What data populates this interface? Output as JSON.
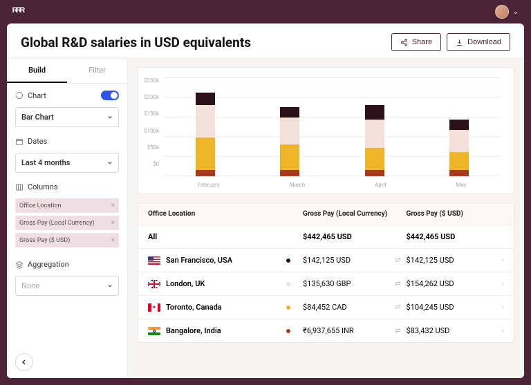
{
  "header": {
    "title": "Global R&D salaries in USD equivalents",
    "share_label": "Share",
    "download_label": "Download"
  },
  "sidebar": {
    "tabs": {
      "build": "Build",
      "filter": "Filter"
    },
    "chart_label": "Chart",
    "chart_type": "Bar Chart",
    "dates_label": "Dates",
    "dates_value": "Last 4 months",
    "columns_label": "Columns",
    "columns": [
      {
        "label": "Office Location"
      },
      {
        "label": "Gross Pay (Local Currency)"
      },
      {
        "label": "Gross Pay ($ USD)"
      }
    ],
    "aggregation_label": "Aggregation",
    "aggregation_value": "None"
  },
  "chart_data": {
    "type": "bar",
    "stacked": true,
    "ylabel": "",
    "ylim": [
      0,
      250
    ],
    "yticks": [
      "$250k",
      "$200k",
      "$150k",
      "$100k",
      "$50k",
      "$0"
    ],
    "categories": [
      "February",
      "March",
      "April",
      "May"
    ],
    "series": [
      {
        "name": "Bangalore, India",
        "color": "#a63a1e",
        "values": [
          18,
          18,
          18,
          18
        ]
      },
      {
        "name": "Toronto, Canada",
        "color": "#f0b429",
        "values": [
          90,
          70,
          60,
          50
        ]
      },
      {
        "name": "London, UK",
        "color": "#f3e0d6",
        "values": [
          90,
          75,
          80,
          60
        ]
      },
      {
        "name": "San Francisco, USA",
        "color": "#2b1018",
        "values": [
          35,
          30,
          40,
          30
        ]
      }
    ]
  },
  "table": {
    "headers": {
      "location": "Office Location",
      "local": "Gross Pay (Local Currency)",
      "usd": "Gross Pay ($ USD)"
    },
    "total": {
      "label": "All",
      "local": "$442,465 USD",
      "usd": "$442,465 USD"
    },
    "rows": [
      {
        "flag": "us",
        "name": "San Francisco, USA",
        "dot": "#2b1018",
        "local": "$142,125 USD",
        "usd": "$142,125 USD"
      },
      {
        "flag": "gb",
        "name": "London, UK",
        "dot": "#f3e0d6",
        "local": "$135,630 GBP",
        "usd": "$154,262 USD"
      },
      {
        "flag": "ca",
        "name": "Toronto, Canada",
        "dot": "#f0b429",
        "local": "$84,452 CAD",
        "usd": "$104,245 USD"
      },
      {
        "flag": "in",
        "name": "Bangalore, India",
        "dot": "#a63a1e",
        "local": "₹6,937,655 INR",
        "usd": "$83,432 USD"
      }
    ]
  }
}
